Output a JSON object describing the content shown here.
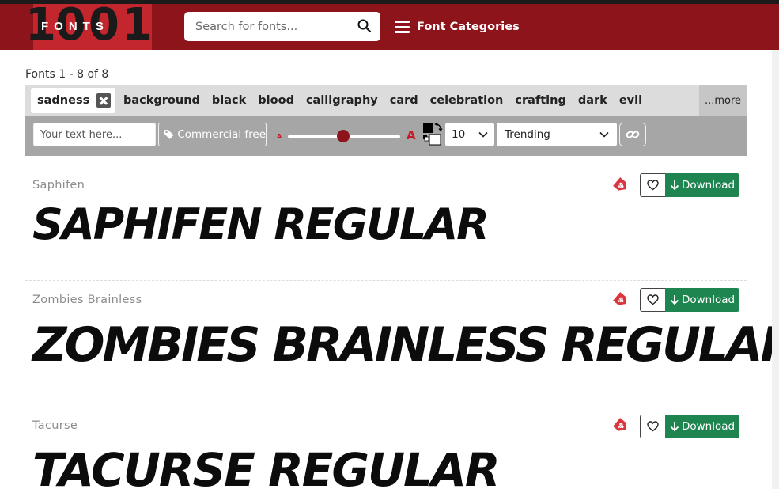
{
  "header": {
    "logo_number": "1001",
    "logo_word": "FONTS",
    "search_placeholder": "Search for fonts...",
    "categories_label": "Font Categories"
  },
  "results": {
    "count_text": "Fonts 1 - 8 of 8"
  },
  "tags": {
    "active": "sadness",
    "items": [
      "background",
      "black",
      "blood",
      "calligraphy",
      "card",
      "celebration",
      "crafting",
      "dark",
      "evil"
    ],
    "more_label": "...more"
  },
  "toolbar": {
    "text_placeholder": "Your text here...",
    "commercial_label": "Commercial free",
    "size_small_label": "A",
    "size_large_label": "A",
    "size_value": "10",
    "sort_value": "Trending",
    "font_size_slider_value": 0.49
  },
  "fonts": [
    {
      "name": "Saphifen",
      "preview": "Saphifen Regular",
      "download_label": "Download"
    },
    {
      "name": "Zombies Brainless",
      "preview": "Zombies Brainless Regular",
      "download_label": "Download"
    },
    {
      "name": "Tacurse",
      "preview": "Tacurse Regular",
      "download_label": "Download"
    }
  ],
  "colors": {
    "header": "#8e141c",
    "accent_red": "#c51b25",
    "download_green": "#1e8450",
    "tagbar": "#dcdcdc",
    "toolbar": "#a6a6a6"
  },
  "icons": [
    "search-icon",
    "menu-icon",
    "close-icon",
    "tag-icon",
    "swap-colors-icon",
    "chevron-down-icon",
    "link-icon",
    "price-tag-icon",
    "heart-icon",
    "download-arrow-icon"
  ]
}
